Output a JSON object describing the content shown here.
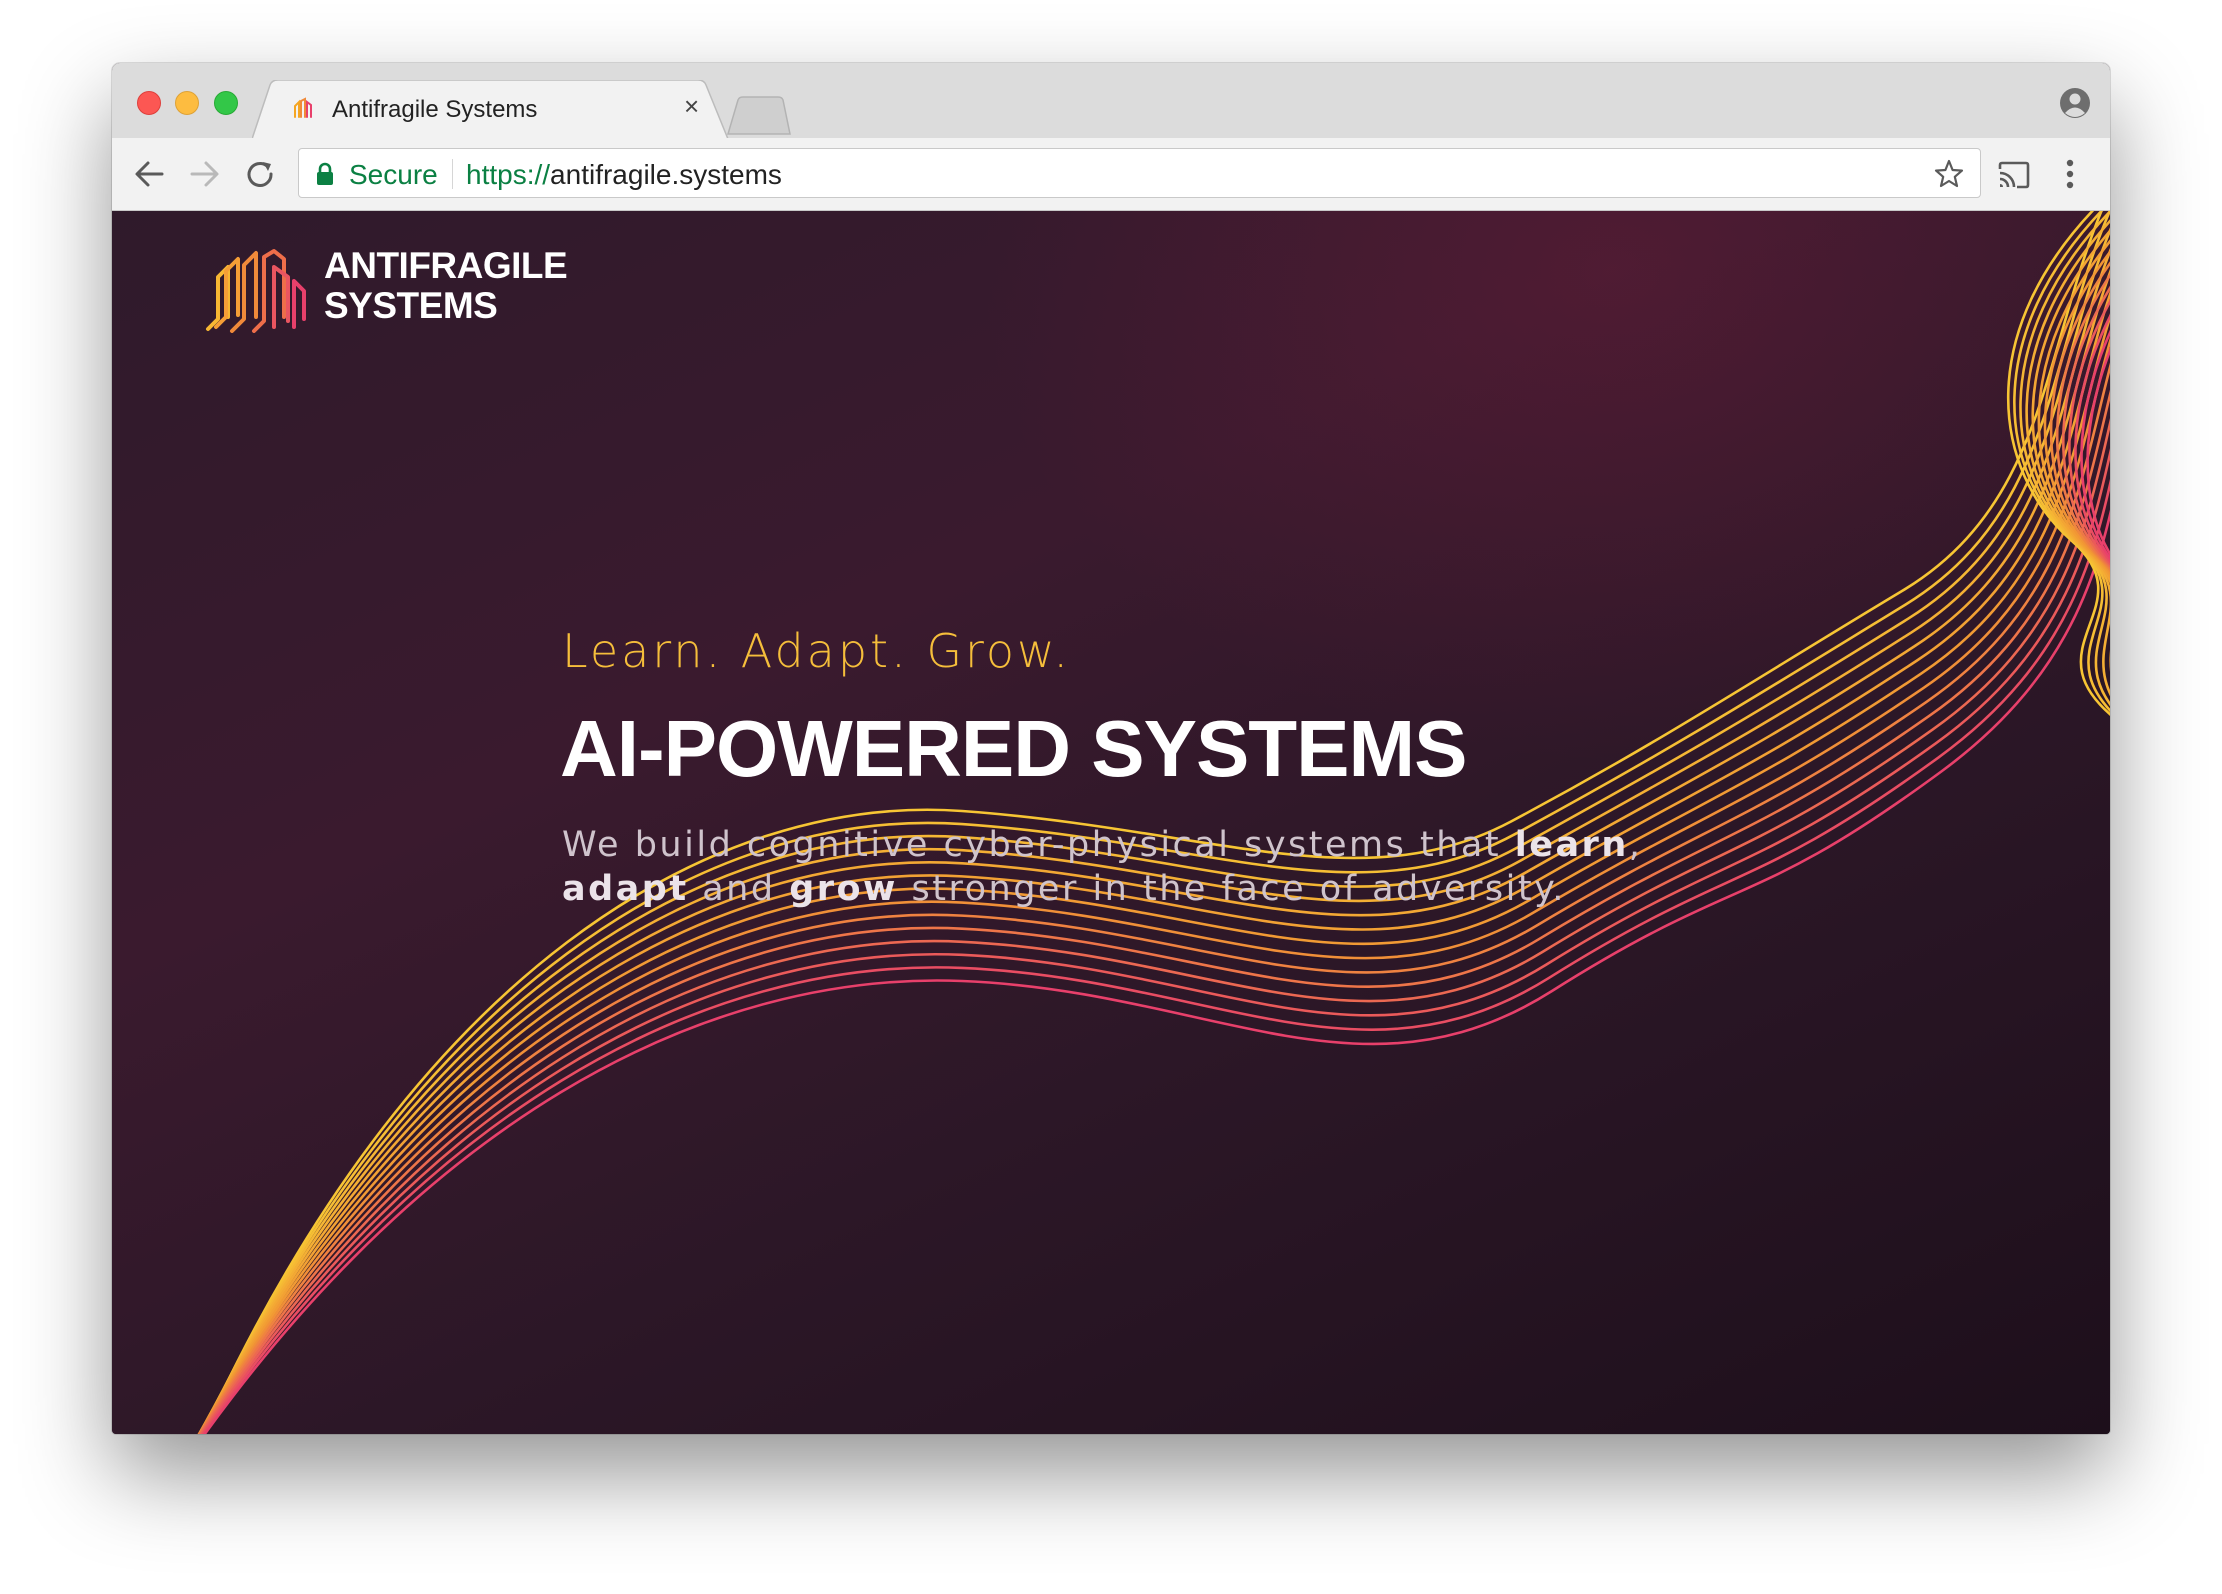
{
  "browser": {
    "tab": {
      "title": "Antifragile Systems",
      "close_glyph": "×"
    },
    "omnibox": {
      "security_label": "Secure",
      "url_scheme": "https://",
      "url_host": "antifragile.systems"
    },
    "icons": {
      "back": "back-arrow-icon",
      "forward": "forward-arrow-icon",
      "reload": "reload-icon",
      "lock": "lock-icon",
      "bookmark": "star-icon",
      "cast": "cast-icon",
      "menu": "kebab-menu-icon",
      "profile": "profile-icon"
    },
    "colors": {
      "secure_green": "#0b8043",
      "tabstrip": "#dcdcdc",
      "toolbar": "#f2f2f2"
    }
  },
  "site": {
    "logo": {
      "line1": "ANTIFRAGILE",
      "line2": "SYSTEMS"
    },
    "hero": {
      "tagline": "Learn. Adapt. Grow.",
      "headline": "AI-POWERED SYSTEMS",
      "description": {
        "part1": "We build cognitive cyber-physical systems that ",
        "bold1": "learn",
        "part2": ",",
        "bold2": "adapt",
        "part3": " and ",
        "bold3": "grow",
        "part4": " stronger in the face of adversity."
      }
    },
    "colors": {
      "background": "#2b1727",
      "accent_yellow": "#f5be3b",
      "accent_pink": "#e8406b",
      "headline": "#ffffff",
      "body_text": "#cfc3cc"
    }
  }
}
